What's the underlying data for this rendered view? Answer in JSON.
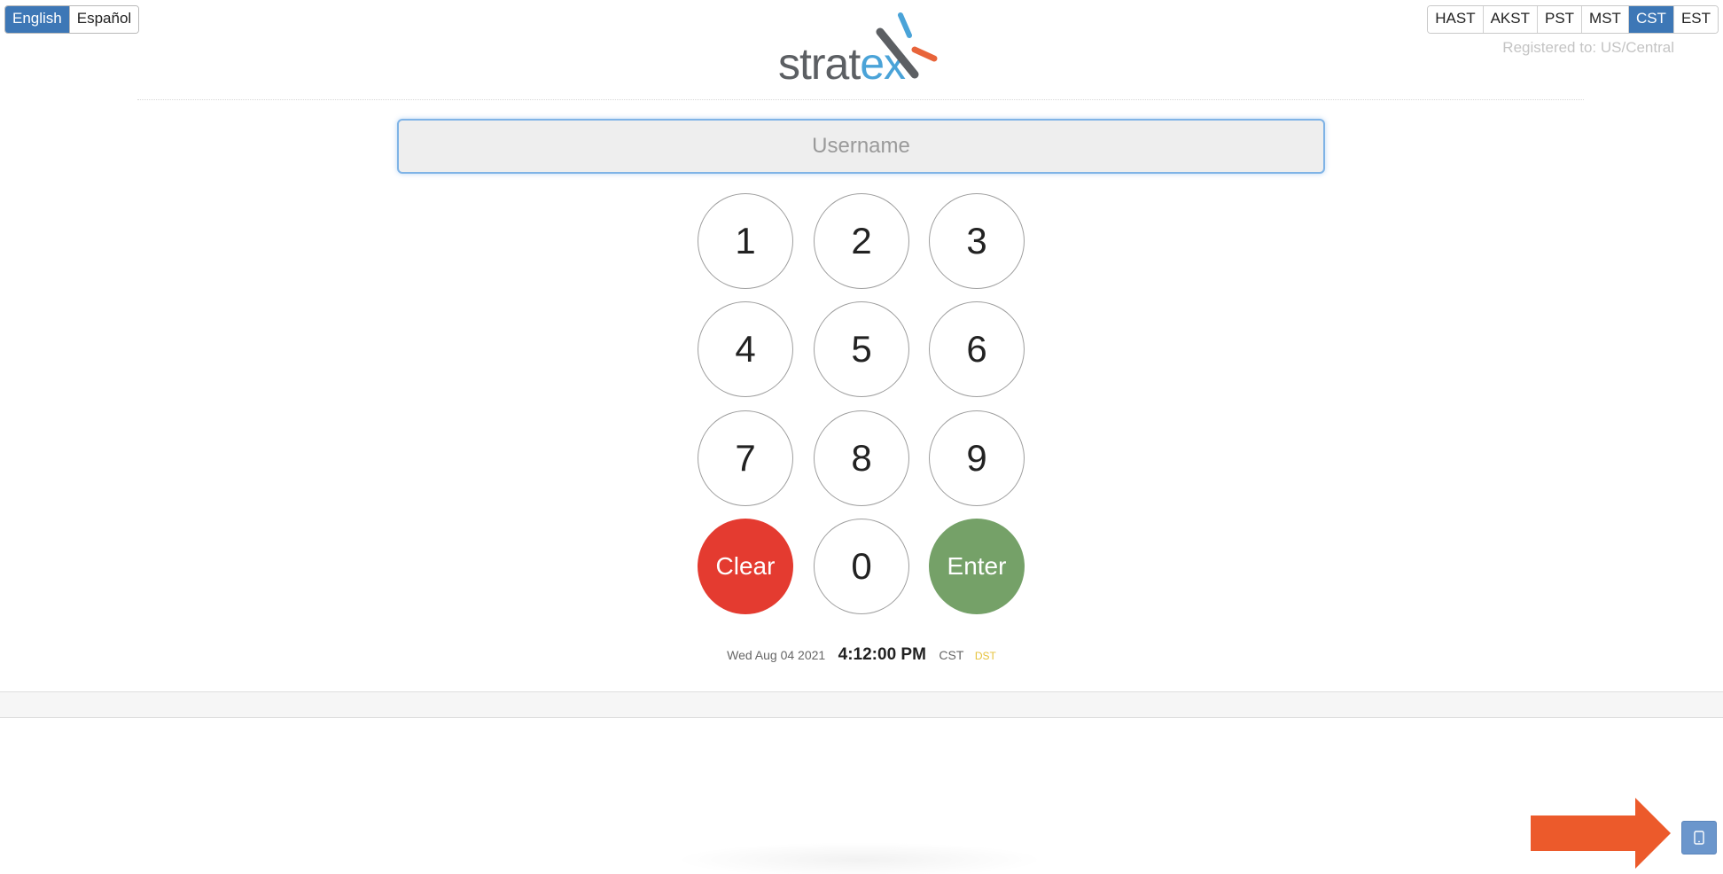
{
  "language": {
    "options": [
      "English",
      "Español"
    ],
    "selected": "English"
  },
  "timezones": {
    "options": [
      "HAST",
      "AKST",
      "PST",
      "MST",
      "CST",
      "EST"
    ],
    "selected": "CST",
    "registered_text": "Registered to: US/Central"
  },
  "logo": {
    "text_part1": "strat",
    "text_part2": "ex"
  },
  "login": {
    "username_placeholder": "Username",
    "username_value": ""
  },
  "keypad": {
    "k1": "1",
    "k2": "2",
    "k3": "3",
    "k4": "4",
    "k5": "5",
    "k6": "6",
    "k7": "7",
    "k8": "8",
    "k9": "9",
    "clear": "Clear",
    "k0": "0",
    "enter": "Enter"
  },
  "clock": {
    "date": "Wed Aug 04 2021",
    "time": "4:12:00 PM",
    "timezone": "CST",
    "dst": "DST"
  },
  "colors": {
    "accent_blue": "#3d77b6",
    "clear_red": "#e43b30",
    "enter_green": "#75a168",
    "arrow_orange": "#ec5a2b"
  },
  "icons": {
    "device_button": "tablet-icon",
    "arrow": "arrow-right-icon"
  }
}
